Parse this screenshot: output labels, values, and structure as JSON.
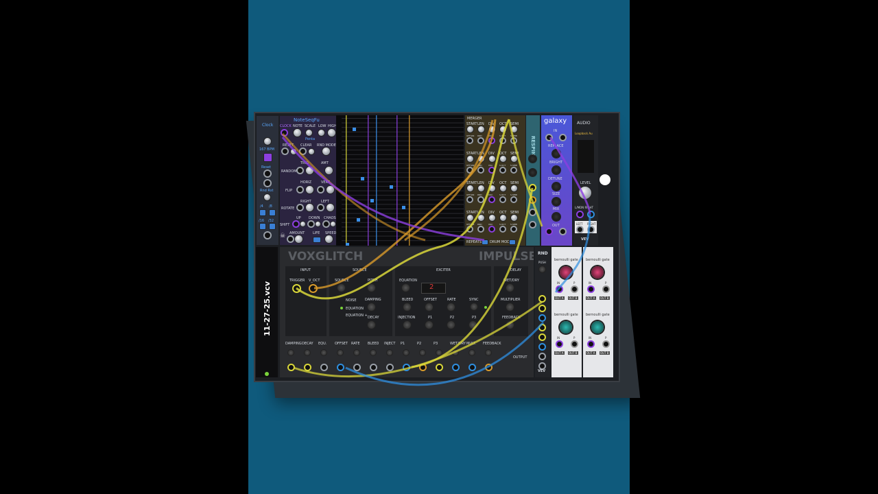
{
  "patch_file": "11-27-25.vcv",
  "modules": {
    "clock": {
      "title": "Clock",
      "bpm": "167 BPM",
      "reset": "Reset",
      "rnd_rst": "Rnd Rst",
      "div_a": "/4",
      "div_b": "/8",
      "div_c": "/16",
      "div_d": "/32"
    },
    "noteseq": {
      "title": "NoteSeqFu",
      "row1": [
        "CLOCK",
        "NOTE",
        "SCALE",
        "LOW",
        "HIGH"
      ],
      "row2": [
        "RESET",
        "CLEAR",
        "RND MODE"
      ],
      "sub1": "Penta",
      "trig": "TRIG",
      "amt": "AMT",
      "random": "RANDOM",
      "horiz": "HORIZ",
      "vert": "VERT",
      "flip": "FLIP",
      "right": "RIGHT",
      "left": "LEFT",
      "rotate": "ROTATE",
      "up": "UP",
      "down": "DOWN",
      "chaos": "CHAOS",
      "shift": "SHIFT",
      "amount": "AMOUNT",
      "life": "LIFE",
      "speed": "SPEED"
    },
    "seq_lanes": {
      "labels": [
        "START",
        "LEN",
        "DIV",
        "OCT",
        "SEMI"
      ],
      "sub": [
        "OFF/ON",
        "RND",
        "OSC",
        "S.OCT",
        "S.SEMI"
      ],
      "top": "MERGER",
      "repeats": "REPEATS",
      "drum_mode": "DRUM MODE"
    },
    "slider": {
      "title": "RESPIN"
    },
    "galaxy": {
      "title": "galaxy",
      "in": "IN",
      "replace": "REPLACE",
      "bright": "BRIGHT",
      "detune": "DETUNE",
      "size": "SIZE",
      "mix": "MIX",
      "out": "OUT"
    },
    "audio": {
      "title": "AUDIO",
      "device": "Loopback Au",
      "level": "LEVEL",
      "left_right": "L/MON RIGHT",
      "left": "LEFT",
      "right": "RIGHT",
      "brand": "VEV"
    },
    "voxglitch": {
      "brand": "VOXGLITCH",
      "name": "IMPULSE",
      "tabs": [
        "INPUT",
        "SOURCE",
        "EXCITER",
        "DELAY"
      ],
      "trigger": "TRIGGER",
      "voct": "V_OCT",
      "source": "SOURCE",
      "pitch": "PITCH",
      "noise": "NOISE",
      "equation": "EQUATION",
      "equation_plus": "EQUATION +",
      "damping": "DAMPING",
      "decay": "DECAY",
      "eq_label": "EQUATION",
      "display": "2",
      "bleed": "BLEED",
      "offset": "OFFSET",
      "rate": "RATE",
      "sync": "SYNC",
      "injection": "INJECTION",
      "p1": "P1",
      "p2": "P2",
      "p3": "P3",
      "wetdry": "WET/DRY",
      "multiplier": "MULTIPLIER",
      "feedback": "FEEDBACK",
      "bottom": [
        "DAMPING",
        "DECAY",
        "EQU.",
        "OFFSET",
        "RATE",
        "BLEED",
        "INJECT",
        "P1",
        "P2",
        "P3",
        "WET/DRY",
        "MULT.",
        "FEEDBACK"
      ],
      "output": "OUTPUT"
    },
    "rnd": {
      "title": "RND",
      "push": "PUSH",
      "brand": "VEV"
    },
    "bernoulli": {
      "title": "bernoulli gate",
      "out_a": "OUT A",
      "out_b": "OUT B",
      "in": "IN",
      "p": "P"
    }
  },
  "colors": {
    "background": "#0f5a7c",
    "cable_yellow": "#d9d73a",
    "cable_purple": "#8c3fe0",
    "cable_blue": "#2f8fe0",
    "cable_orange": "#d89a2a",
    "step_blue": "#3a8fe8"
  }
}
